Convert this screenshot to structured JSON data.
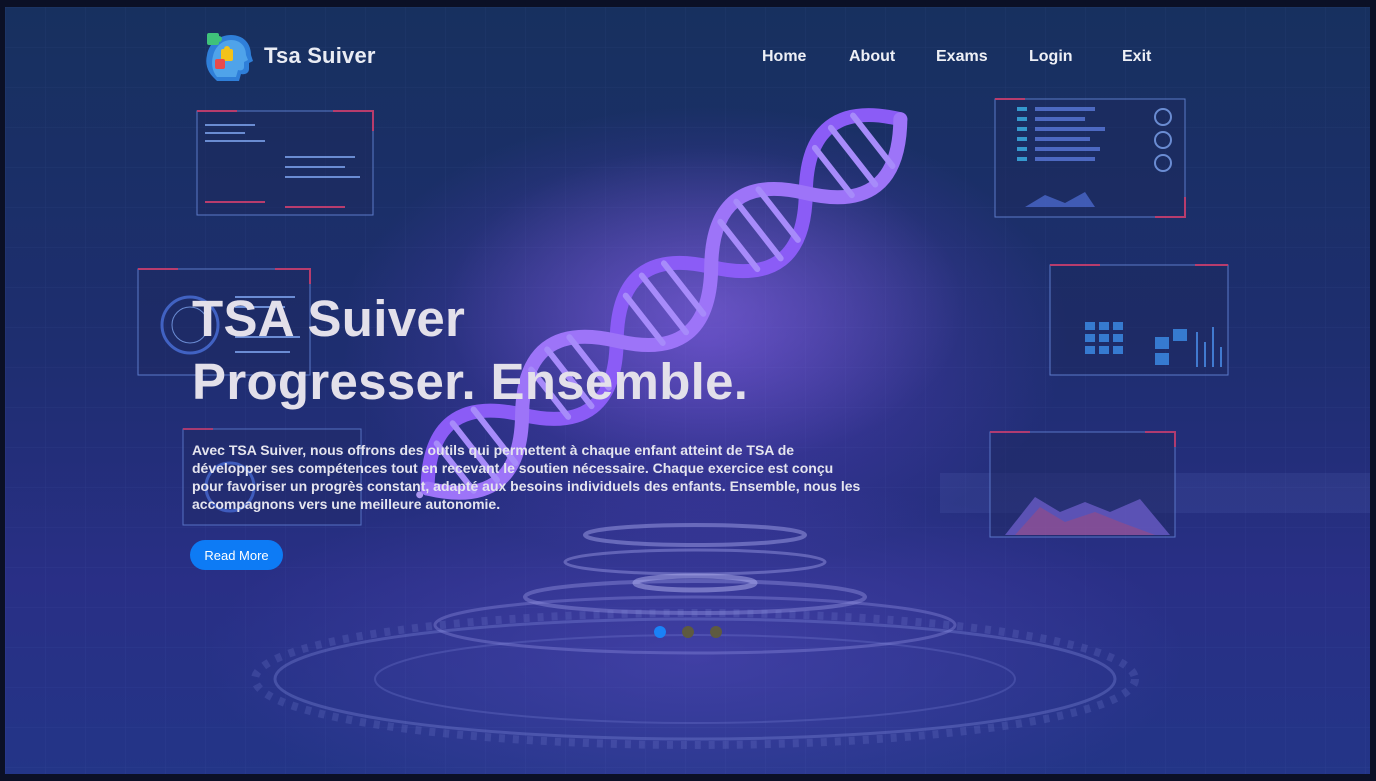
{
  "brand": {
    "name": "Tsa Suiver"
  },
  "nav": {
    "items": [
      {
        "label": "Home"
      },
      {
        "label": "About"
      },
      {
        "label": "Exams"
      },
      {
        "label": "Login"
      },
      {
        "label": "Exit"
      }
    ]
  },
  "hero": {
    "title_line1": "TSA Suiver",
    "title_line2": "Progresser. Ensemble.",
    "description": "Avec TSA Suiver, nous offrons des outils qui permettent à chaque enfant atteint de TSA de développer ses compétences tout en recevant le soutien nécessaire. Chaque exercice est conçu pour favoriser un progrès constant, adapté aux besoins individuels des enfants. Ensemble, nous les accompagnons vers une meilleure autonomie.",
    "read_more_label": "Read More"
  },
  "carousel": {
    "slide_count": 3,
    "active_index": 0
  },
  "colors": {
    "accent": "#0d7bf5",
    "dot_active": "#1a82f7",
    "dot_inactive": "#5e5a40",
    "dna": "#8b5cf6",
    "hud_accent": "#e0406e"
  },
  "icons": {
    "logo": "head-with-puzzle-pieces-icon",
    "background": "dna-helix-hologram"
  }
}
